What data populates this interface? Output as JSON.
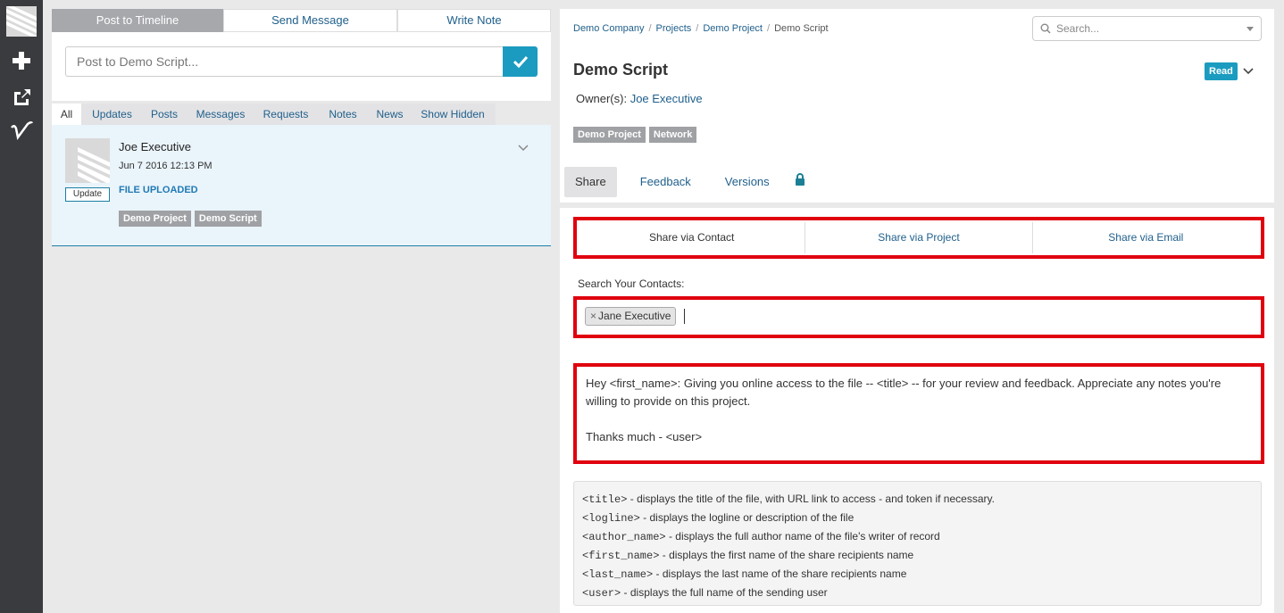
{
  "left_feed": {
    "tabs": [
      "Post to Timeline",
      "Send Message",
      "Write Note"
    ],
    "post_placeholder": "Post to Demo Script...",
    "filters": [
      "All",
      "Updates",
      "Posts",
      "Messages",
      "Requests",
      "Notes",
      "News",
      "Show Hidden"
    ],
    "item": {
      "author": "Joe Executive",
      "date": "Jun 7 2016 12:13 PM",
      "badge": "Update",
      "status": "FILE UPLOADED",
      "tags": [
        "Demo Project",
        "Demo Script"
      ]
    }
  },
  "header": {
    "breadcrumbs": [
      "Demo Company",
      "Projects",
      "Demo Project",
      "Demo Script"
    ],
    "search_placeholder": "Search...",
    "title": "Demo Script",
    "access_badge": "Read",
    "owners_label": "Owner(s):",
    "owner": "Joe Executive",
    "tags": [
      "Demo Project",
      "Network"
    ],
    "tabs": [
      "Share",
      "Feedback",
      "Versions"
    ]
  },
  "share": {
    "tabs": [
      "Share via Contact",
      "Share via Project",
      "Share via Email"
    ],
    "contacts_label": "Search Your Contacts:",
    "chip_remove": "×",
    "chip": "Jane Executive",
    "message": "Hey <first_name>: Giving you online access to the file -- <title> -- for your review and feedback. Appreciate any notes you're willing to provide on this project.\n\nThanks much - <user>",
    "help": [
      {
        "token": "<title>",
        "desc": " - displays the title of the file, with URL link to access - and token if necessary."
      },
      {
        "token": "<logline>",
        "desc": " - displays the logline or description of the file"
      },
      {
        "token": "<author_name>",
        "desc": " - displays the full author name of the file's writer of record"
      },
      {
        "token": "<first_name>",
        "desc": " - displays the first name of the share recipients name"
      },
      {
        "token": "<last_name>",
        "desc": " - displays the last name of the share recipients name"
      },
      {
        "token": "<user>",
        "desc": " - displays the full name of the sending user"
      }
    ]
  },
  "colors": {
    "accent": "#1b9bc0",
    "highlight": "#e0000e",
    "rail": "#3a3b3e"
  },
  "icons": [
    "logo-icon",
    "add-icon",
    "share-icon",
    "v-logo-icon",
    "checkmark-icon",
    "chevron-down-icon",
    "search-icon",
    "lock-icon"
  ]
}
